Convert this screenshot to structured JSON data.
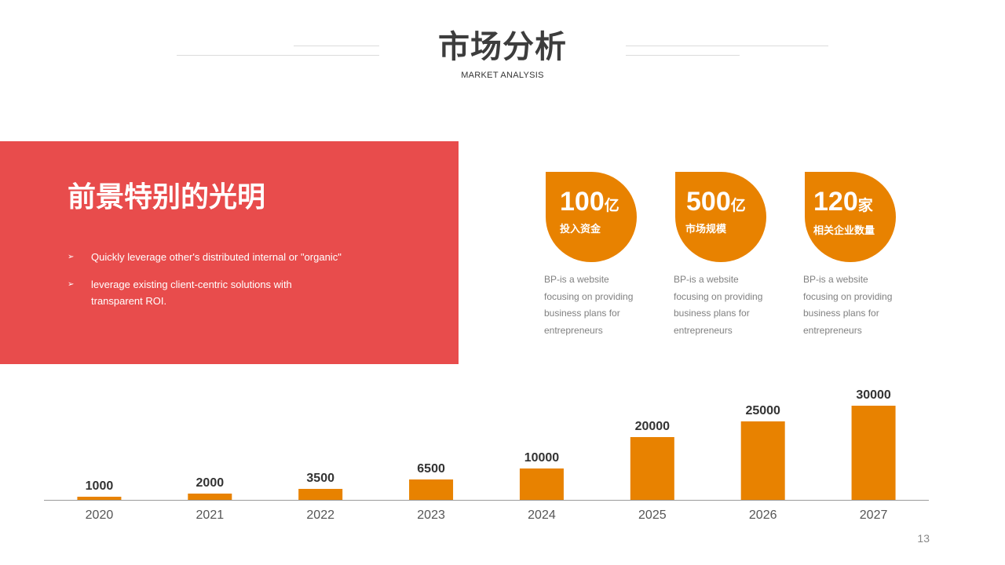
{
  "header": {
    "title": "市场分析",
    "subtitle": "MARKET ANALYSIS"
  },
  "panel": {
    "heading": "前景特别的光明",
    "bullet_icon": "arrow-bullet-icon",
    "bullets": [
      {
        "text": "Quickly leverage other's distributed internal or \"organic\""
      },
      {
        "text": "leverage existing client-centric solutions with transparent ROI."
      }
    ]
  },
  "stats": [
    {
      "number": "100",
      "unit": "亿",
      "label": "投入资金",
      "description": "BP-is a website focusing on providing business plans for entrepreneurs"
    },
    {
      "number": "500",
      "unit": "亿",
      "label": "市场规模",
      "description": "BP-is a website focusing on providing business plans for entrepreneurs"
    },
    {
      "number": "120",
      "unit": "家",
      "label": "相关企业数量",
      "description": "BP-is a website focusing on providing business plans for entrepreneurs"
    }
  ],
  "chart_data": {
    "type": "bar",
    "categories": [
      "2020",
      "2021",
      "2022",
      "2023",
      "2024",
      "2025",
      "2026",
      "2027"
    ],
    "values": [
      1000,
      2000,
      3500,
      6500,
      10000,
      20000,
      25000,
      30000
    ],
    "title": "",
    "xlabel": "",
    "ylabel": "",
    "ylim": [
      0,
      30000
    ],
    "grid": false,
    "legend": "none"
  },
  "colors": {
    "accent_orange": "#e88200",
    "panel_red": "#e84c4c",
    "title_text": "#3d3d3d"
  },
  "footer": {
    "page_number": "13"
  }
}
